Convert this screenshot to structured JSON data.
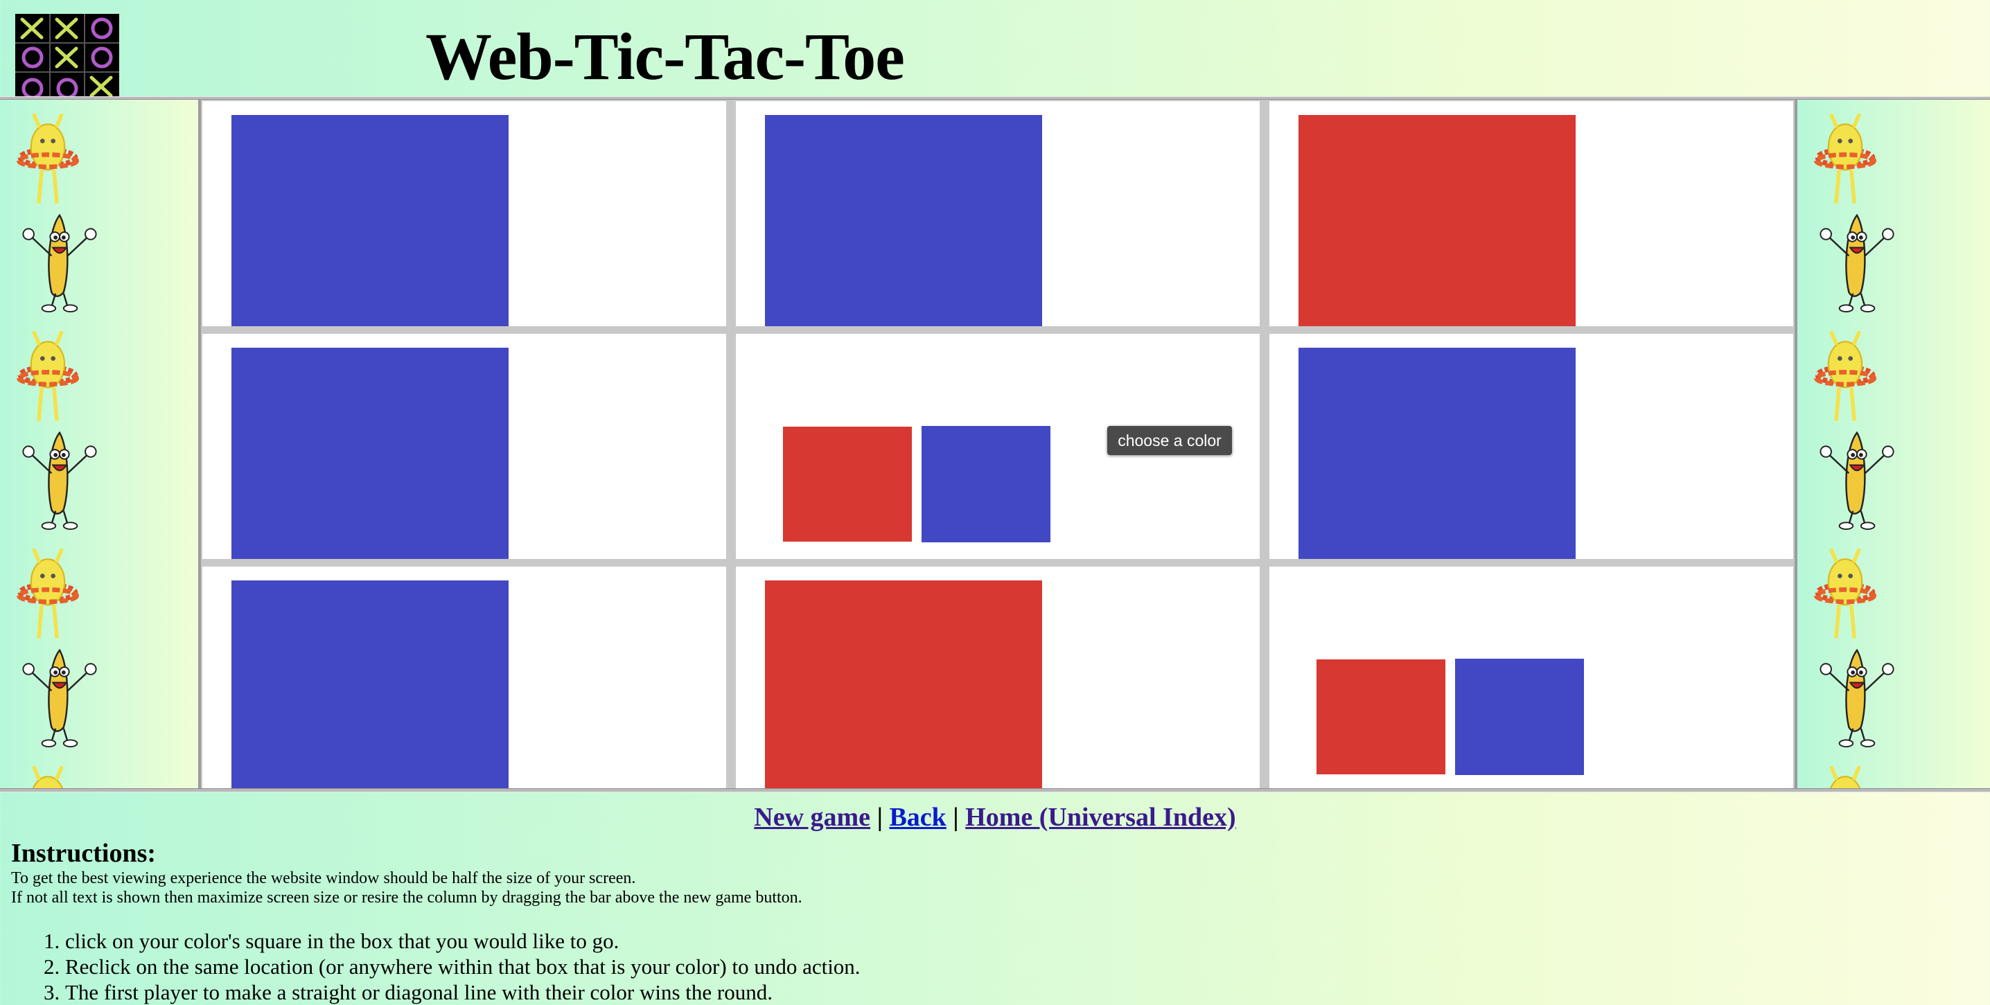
{
  "header": {
    "title": "Web-Tic-Tac-Toe"
  },
  "board": {
    "cells": [
      {
        "type": "single",
        "color": "blue"
      },
      {
        "type": "single",
        "color": "blue"
      },
      {
        "type": "single",
        "color": "red"
      },
      {
        "type": "single",
        "color": "blue"
      },
      {
        "type": "choice"
      },
      {
        "type": "single",
        "color": "blue"
      },
      {
        "type": "single",
        "color": "blue"
      },
      {
        "type": "single",
        "color": "red"
      },
      {
        "type": "choice"
      }
    ],
    "tooltip": "choose a color"
  },
  "nav": {
    "new_game": "New game",
    "separator": "|",
    "back": "Back",
    "home": "Home (Universal Index)"
  },
  "instructions": {
    "title": "Instructions:",
    "note1": "To get the best viewing experience the website window should be half the size of your screen.",
    "note2": "If not all text is shown then maximize screen size or resire the column by dragging the bar above the new game button.",
    "steps": [
      "click on your color's square in the box that you would like to go.",
      "Reclick on the same location (or anywhere within that box that is your color) to undo action.",
      "The first player to make a straight or diagonal line with their color wins the round."
    ]
  },
  "colors": {
    "red": "#d83832",
    "blue": "#4248c4",
    "link": "#3a1a8c",
    "link_visited": "#0a1acc"
  },
  "icons": {
    "logo": "tic-tac-toe-logo",
    "mascot_a": "hula-hoop-chick",
    "mascot_b": "dancing-banana"
  }
}
